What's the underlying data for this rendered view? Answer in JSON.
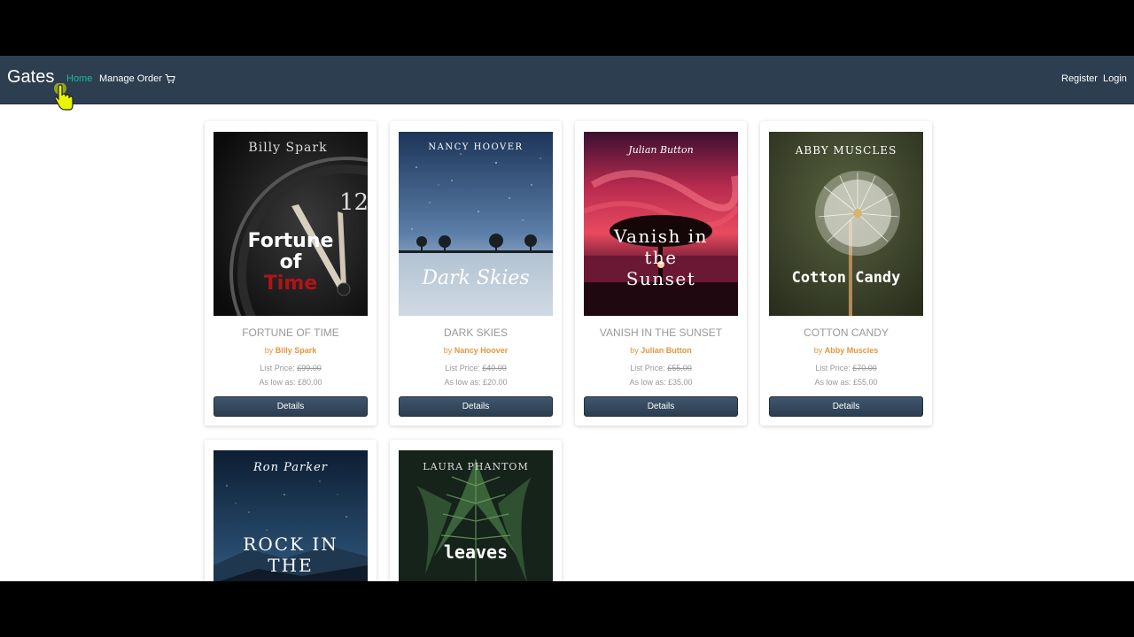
{
  "nav": {
    "brand": "Gates",
    "home": "Home",
    "manage_order": "Manage Order",
    "register": "Register",
    "login": "Login"
  },
  "colors": {
    "navbar": "#2c3e50",
    "active_link": "#1abc9c",
    "author": "#e5963b",
    "button": "#34495e"
  },
  "books": [
    {
      "title": "FORTUNE OF TIME",
      "by": "by ",
      "author": "Billy Spark",
      "list_label": "List Price: ",
      "list_price": "£99.00",
      "low_label": "As low as: ",
      "low_price": "£80.00",
      "button": "Details",
      "cover": {
        "author": "Billy Spark",
        "line1": "Fortune",
        "line2": "of",
        "line3": "Time",
        "number": "12"
      }
    },
    {
      "title": "DARK SKIES",
      "by": "by ",
      "author": "Nancy Hoover",
      "list_label": "List Price: ",
      "list_price": "£40.00",
      "low_label": "As low as: ",
      "low_price": "£20.00",
      "button": "Details",
      "cover": {
        "author": "NANCY HOOVER",
        "line1": "Dark Skies"
      }
    },
    {
      "title": "VANISH IN THE SUNSET",
      "by": "by ",
      "author": "Julian Button",
      "list_label": "List Price: ",
      "list_price": "£55.00",
      "low_label": "As low as: ",
      "low_price": "£35.00",
      "button": "Details",
      "cover": {
        "author": "Julian Button",
        "line1": "Vanish in",
        "line2": "the",
        "line3": "Sunset"
      }
    },
    {
      "title": "COTTON CANDY",
      "by": "by ",
      "author": "Abby Muscles",
      "list_label": "List Price: ",
      "list_price": "£70.00",
      "low_label": "As low as: ",
      "low_price": "£55.00",
      "button": "Details",
      "cover": {
        "author": "ABBY MUSCLES",
        "line1": "Cotton Candy"
      }
    },
    {
      "cover": {
        "author": "Ron Parker",
        "line1": "ROCK IN",
        "line2": "THE"
      }
    },
    {
      "cover": {
        "author": "LAURA PHANTOM",
        "line1": "leaves"
      }
    }
  ]
}
